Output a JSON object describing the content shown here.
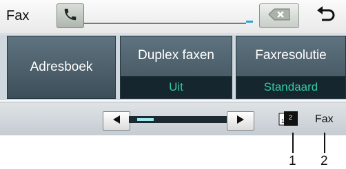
{
  "header": {
    "mode_label": "Fax",
    "phone_icon": "phone-icon",
    "delete_icon": "backspace-x-icon",
    "back_icon": "return-arrow-icon"
  },
  "buttons": [
    {
      "label": "Adresboek"
    },
    {
      "label": "Duplex faxen",
      "value": "Uit"
    },
    {
      "label": "Faxresolutie",
      "value": "Standaard"
    }
  ],
  "footer": {
    "prev_icon": "left-arrow-icon",
    "next_icon": "right-arrow-icon",
    "page_icon": {
      "front": "1",
      "back": "2"
    },
    "status": "Fax",
    "scroll_position": 0.05
  },
  "callouts": [
    {
      "number": "1"
    },
    {
      "number": "2"
    }
  ],
  "colors": {
    "tile": "#4a5d69",
    "value_text": "#35c7a3",
    "value_bg": "#16262f",
    "accent": "#2da3d0"
  }
}
